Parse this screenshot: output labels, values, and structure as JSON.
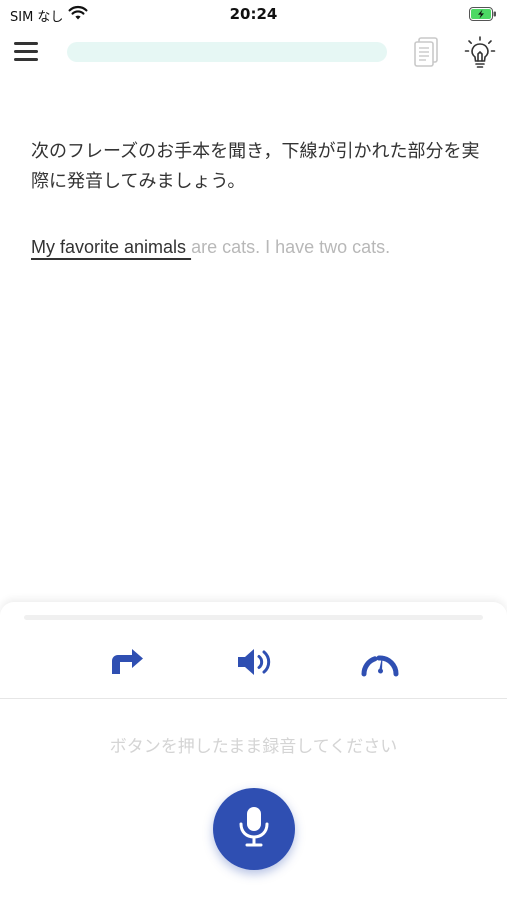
{
  "status_bar": {
    "carrier": "SIM なし",
    "time": "20:24",
    "battery_icon": "battery-charging-icon",
    "wifi_icon": "wifi-icon"
  },
  "nav": {
    "menu_icon": "hamburger-menu-icon",
    "progress": 0.0,
    "notes_icon": "notes-icon",
    "hint_icon": "lightbulb-icon"
  },
  "lesson": {
    "instruction": "次のフレーズのお手本を聞き，下線が引かれた部分を実際に発音してみましょう。",
    "phrase_target": "My favorite animals ",
    "phrase_rest": "are cats.  I have two cats."
  },
  "panel": {
    "controls": [
      "retry-icon",
      "speaker-icon",
      "speed-gauge-icon"
    ],
    "hold_instruction": "ボタンを押したまま録音してください",
    "mic_icon": "microphone-icon"
  },
  "colors": {
    "accent": "#2f4fb2",
    "progress_track": "#e6f7f4",
    "muted_text": "#b8b8b8"
  }
}
